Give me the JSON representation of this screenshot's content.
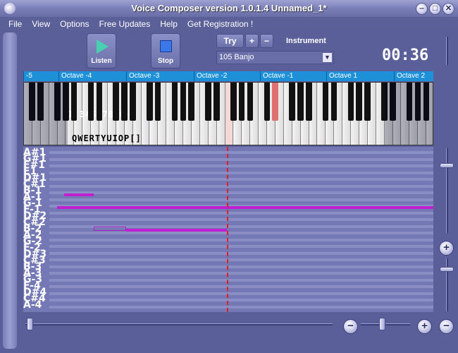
{
  "window": {
    "title": "Voice Composer version 1.0.1.4 Unnamed_1*"
  },
  "titlebar_buttons": {
    "minimize": "‒",
    "maximize": "□",
    "close": "✕"
  },
  "menu": [
    "File",
    "View",
    "Options",
    "Free Updates",
    "Help",
    "Get Registration !"
  ],
  "toolbar": {
    "listen_label": "Listen",
    "stop_label": "Stop",
    "try_label": "Try",
    "plus_label": "+",
    "minus_label": "−",
    "instrument_label": "Instrument",
    "instrument_value": "105 Banjo",
    "timer": "00:36"
  },
  "ruler": {
    "octaves": [
      "-5",
      "Octave -4",
      "Octave -3",
      "Octave -2",
      "Octave -1",
      "Octave 1",
      "Octave 2"
    ]
  },
  "keyboard": {
    "number_keys": "1 345 78 0-+",
    "letter_keys": "QWERTYUIOP[]",
    "highlighted_key_color": "#e07070"
  },
  "roll": {
    "note_labels": [
      "A#1",
      "G#1",
      "F#1",
      "E1",
      "D#1",
      "C#1",
      "B-1",
      "A-1",
      "G-1",
      "F-1",
      "D#2",
      "C#2",
      "B-2",
      "A-2",
      "G-2",
      "F-2",
      "D#3",
      "C#3",
      "B-3",
      "A-3",
      "G-3",
      "F-4",
      "D#4",
      "C#4",
      "A-4"
    ],
    "note_color": "#c020d0",
    "playhead_color": "#e02020"
  },
  "zoom": {
    "plus": "+",
    "minus": "−"
  }
}
